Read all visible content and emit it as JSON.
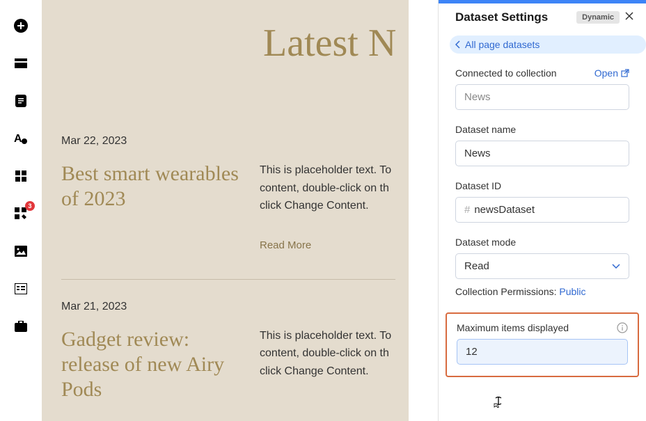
{
  "sidebar": {
    "badge_count": "3"
  },
  "page": {
    "title": "Latest N",
    "articles": [
      {
        "date": "Mar 22, 2023",
        "title": "Best smart wearables of 2023",
        "text_line1": "This is placeholder text. To",
        "text_line2": "content, double-click on th",
        "text_line3": "click Change Content.",
        "read_more": "Read More"
      },
      {
        "date": "Mar 21, 2023",
        "title": "Gadget review: release of new Airy Pods",
        "text_line1": "This is placeholder text. To",
        "text_line2": "content, double-click on th",
        "text_line3": "click Change Content."
      }
    ]
  },
  "panel": {
    "title": "Dataset Settings",
    "badge": "Dynamic",
    "back_link": "All page datasets",
    "connected_label": "Connected to collection",
    "open_label": "Open",
    "connected_value": "News",
    "dataset_name_label": "Dataset name",
    "dataset_name_value": "News",
    "dataset_id_label": "Dataset ID",
    "dataset_id_hash": "#",
    "dataset_id_value": "newsDataset",
    "dataset_mode_label": "Dataset mode",
    "dataset_mode_value": "Read",
    "permissions_prefix": "Collection Permissions:",
    "permissions_value": "Public",
    "max_items_label": "Maximum items displayed",
    "max_items_value": "12"
  }
}
